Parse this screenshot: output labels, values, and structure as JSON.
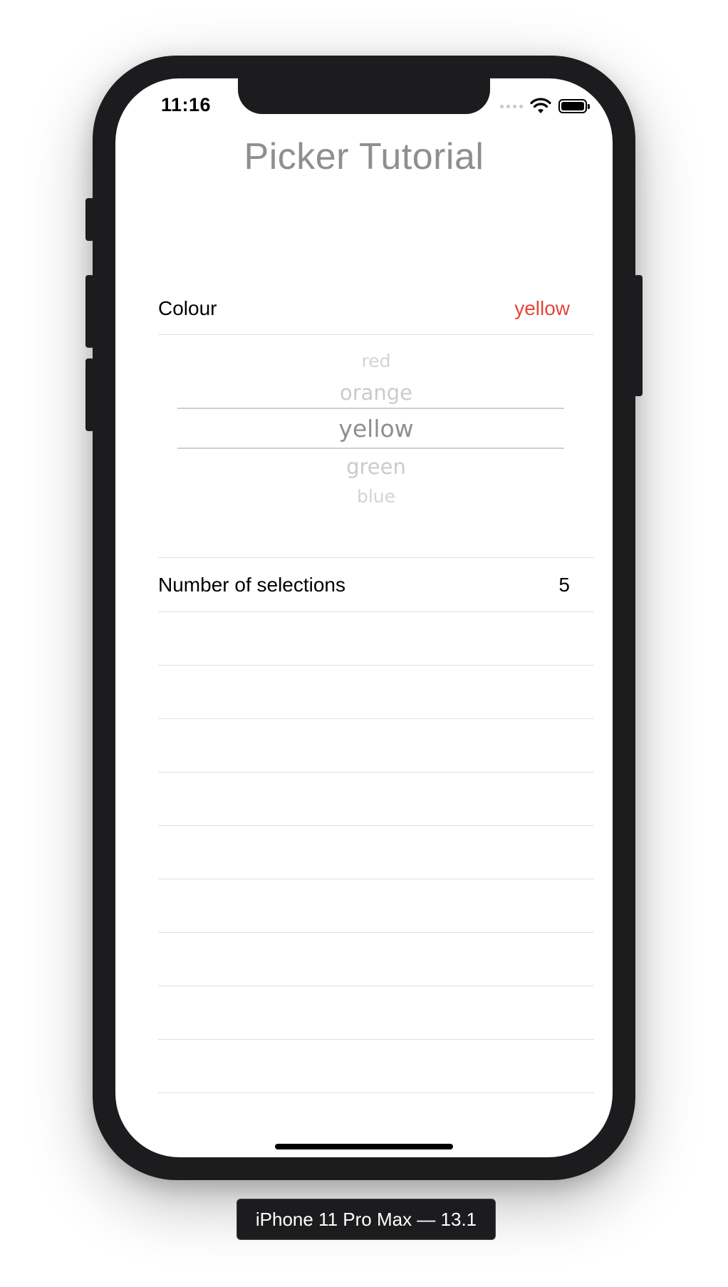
{
  "status_bar": {
    "time": "11:16",
    "icons": [
      "signal-icon",
      "wifi-icon",
      "battery-icon"
    ]
  },
  "app": {
    "title": "Picker Tutorial",
    "colour_row": {
      "label": "Colour",
      "value": "yellow",
      "value_color": "#e5453a"
    },
    "picker": {
      "items": [
        "red",
        "orange",
        "yellow",
        "green",
        "blue"
      ],
      "selected": "yellow"
    },
    "selections_row": {
      "label": "Number of selections",
      "value": "5"
    }
  },
  "device_label": "iPhone 11 Pro Max — 13.1"
}
